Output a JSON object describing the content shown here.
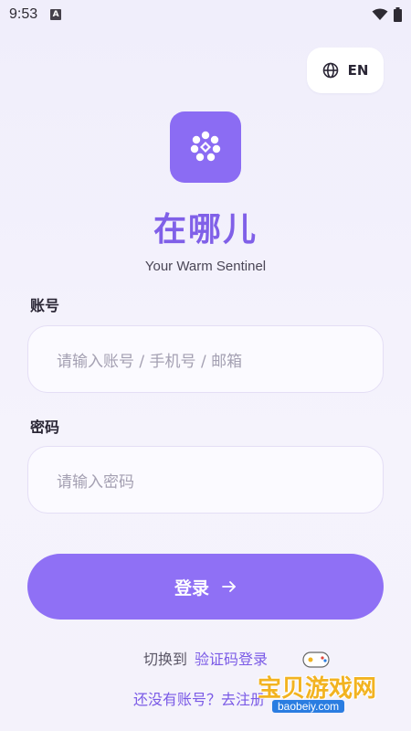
{
  "status_bar": {
    "time": "9:53",
    "notification_icon": "a-icon",
    "wifi_icon": "wifi-icon",
    "battery_icon": "battery-icon"
  },
  "language_button": {
    "icon": "globe-icon",
    "label": "EN"
  },
  "logo": {
    "icon": "flower-icon",
    "color": "#8b6cf3"
  },
  "app_title": "在哪儿",
  "subtitle": "Your Warm Sentinel",
  "account": {
    "label": "账号",
    "placeholder": "请输入账号 / 手机号 / 邮箱"
  },
  "password": {
    "label": "密码",
    "placeholder": "请输入密码"
  },
  "login_button": {
    "label": "登录",
    "icon": "arrow-right-icon",
    "color": "#8f70f5"
  },
  "switch": {
    "prefix": "切换到",
    "link": "验证码登录"
  },
  "register": {
    "text": "还没有账号？去注册"
  },
  "watermark": {
    "text": "宝贝游戏网",
    "url": "baobeiy.com"
  },
  "colors": {
    "accent": "#8060e8",
    "background": "#f0eefb"
  }
}
